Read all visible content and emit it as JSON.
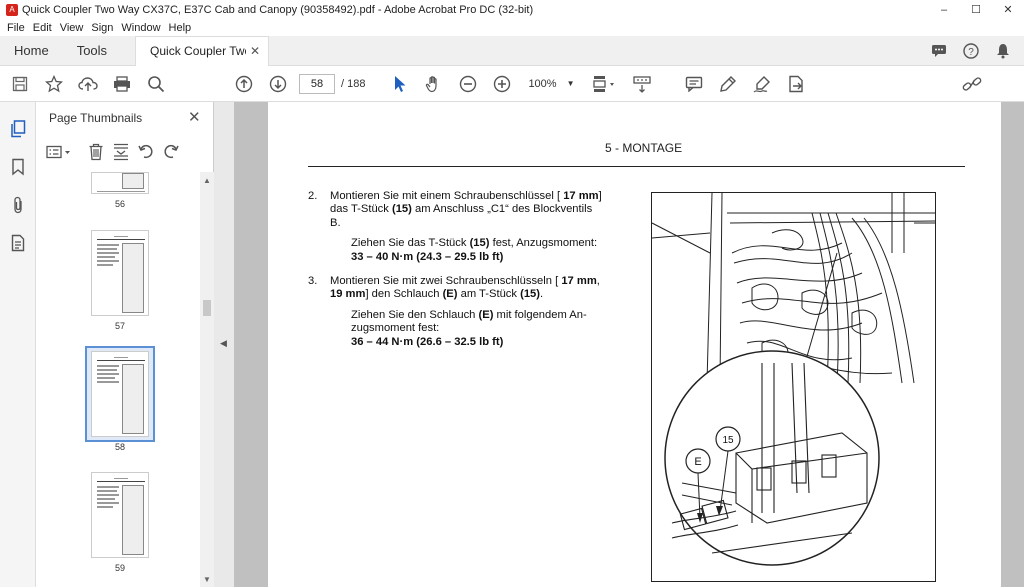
{
  "window": {
    "title": "Quick Coupler Two Way CX37C, E37C Cab and Canopy (90358492).pdf - Adobe Acrobat Pro DC (32-bit)",
    "minimize": "–",
    "maximize": "☐",
    "close": "✕"
  },
  "menu": [
    "File",
    "Edit",
    "View",
    "Sign",
    "Window",
    "Help"
  ],
  "tabs": {
    "home": "Home",
    "tools": "Tools",
    "document": "Quick Coupler Two ...",
    "close": "✕"
  },
  "toolbar": {
    "current_page": "58",
    "page_total": "/ 188",
    "zoom": "100%"
  },
  "panel": {
    "title": "Page Thumbnails",
    "close": "✕",
    "pages": [
      "56",
      "57",
      "58",
      "59"
    ]
  },
  "document": {
    "header": "5 - MONTAGE",
    "step2_num": "2.",
    "step2_text_a": "Montieren Sie mit einem Schraubenschlüssel [",
    "step2_bold_a": "17 mm",
    "step2_text_b": "]",
    "step2_text_c": "das T-Stück",
    "step2_bold_b": "(15)",
    "step2_text_d": "am Anschluss „C1“ des Blockventils",
    "step2_text_e": "B.",
    "step2_sub_a": "Ziehen Sie das T-Stück",
    "step2_sub_bold": "(15)",
    "step2_sub_b": "fest, Anzugsmoment:",
    "step2_torque": "33 – 40 N·m (24.3 – 29.5 lb ft)",
    "step3_num": "3.",
    "step3_text_a": "Montieren Sie mit zwei Schraubenschlüsseln [",
    "step3_bold_a": "17 mm",
    "step3_text_b": ",",
    "step3_bold_b": "19 mm",
    "step3_text_c": "] den Schlauch",
    "step3_bold_c": "(E)",
    "step3_text_d": "am T-Stück",
    "step3_bold_d": "(15)",
    "step3_text_e": ".",
    "step3_sub_a": "Ziehen Sie den Schlauch",
    "step3_sub_bold": "(E)",
    "step3_sub_b": "mit folgendem An-",
    "step3_sub_c": "zugsmoment fest:",
    "step3_torque": "36 – 44 N·m (26.6 – 32.5 lb ft)",
    "callout_e": "E",
    "callout_15": "15"
  }
}
